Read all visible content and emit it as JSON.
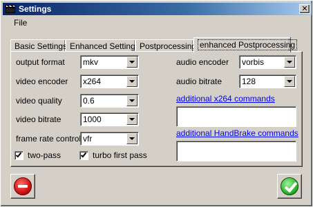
{
  "window": {
    "title": "Settings",
    "close_glyph": "✕"
  },
  "menu": {
    "file": "File"
  },
  "tabs": [
    {
      "label": "Basic Settings"
    },
    {
      "label": "Enhanced Settings"
    },
    {
      "label": "Postprocessing"
    },
    {
      "label": "enhanced Postprocessing",
      "active": true
    }
  ],
  "form": {
    "output_format": {
      "label": "output format",
      "value": "mkv"
    },
    "video_encoder": {
      "label": "video encoder",
      "value": "x264"
    },
    "video_quality": {
      "label": "video quality",
      "value": "0.6"
    },
    "video_bitrate": {
      "label": "video bitrate",
      "value": "1000"
    },
    "frame_rate_control": {
      "label": "frame rate control",
      "value": "vfr"
    },
    "two_pass": {
      "label": "two-pass",
      "checked": true
    },
    "turbo_first_pass": {
      "label": "turbo first pass",
      "checked": true
    },
    "audio_encoder": {
      "label": "audio encoder",
      "value": "vorbis"
    },
    "audio_bitrate": {
      "label": "audio bitrate",
      "value": "128"
    },
    "x264_commands_link": "additional x264 commands",
    "x264_commands_value": "",
    "handbrake_commands_link": "additional HandBrake commands",
    "handbrake_commands_value": ""
  },
  "icons": {
    "app": "clapperboard-icon",
    "cancel": "cancel-icon",
    "ok": "ok-checkmark-icon"
  }
}
